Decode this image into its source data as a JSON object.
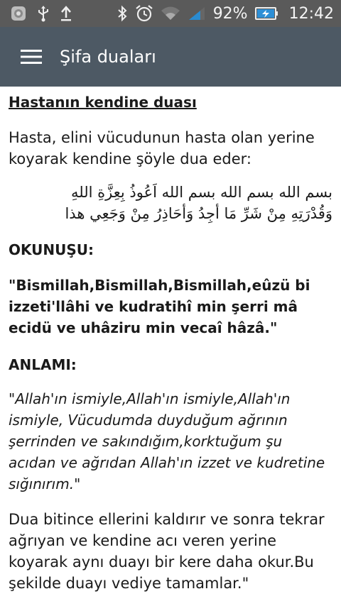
{
  "status_bar": {
    "battery_percent": "92%",
    "time": "12:42",
    "icons": [
      "app-icon",
      "usb-icon",
      "upload-icon",
      "bluetooth-icon",
      "alarm-icon",
      "wifi-icon",
      "signal-icon",
      "battery-charging-icon"
    ]
  },
  "app_bar": {
    "title": "Şifa duaları",
    "menu_icon": "hamburger-menu-icon",
    "color": "#4d5964"
  },
  "article": {
    "heading": "Hastanın kendine duası",
    "intro": "Hasta, elini vücudunun hasta olan yerine koyarak kendine şöyle dua eder:",
    "arabic_line1": "بسم الله بسم الله بسم الله اَعُوذُ بِعِزَّةِ اللهِ",
    "arabic_line2": "وَقُدْرَتِهِ مِنْ شَرِّ مَا أَجِدُ وَأُحَاذِرُ مِنْ وَجَعِي هذا",
    "reading_label": "OKUNUŞU:",
    "reading_text": "\"Bismillah,Bismillah,Bismillah,eûzü bi izzeti'llâhi ve kudratihî min şerri mâ ecidü ve uhâziru min vecaî hâzâ.\"",
    "meaning_label": "ANLAMI:",
    "meaning_text": "\"Allah'ın ismiyle,Allah'ın ismiyle,Allah'ın ismiyle, Vücudumda duyduğum ağrının şerrinden ve sakındığım,korktuğum şu acıdan ve ağrıdan Allah'ın izzet ve kudretine sığınırım.\"",
    "closing_text": "Dua bitince ellerini kaldırır ve sonra tekrar ağrıyan ve kendine acı veren yerine koyarak aynı duayı bir kere daha okur.Bu şekilde duayı vediye tamamlar.\""
  }
}
